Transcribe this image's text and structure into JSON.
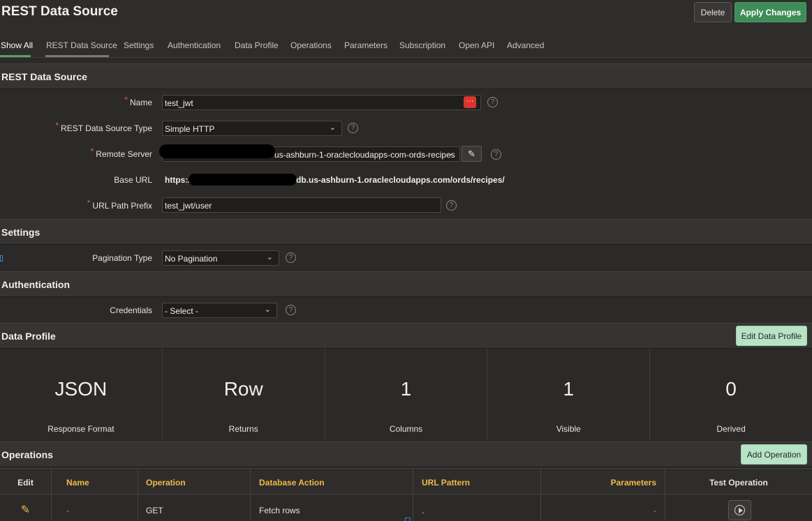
{
  "header": {
    "title": "REST Data Source",
    "delete_label": "Delete",
    "apply_label": "Apply Changes"
  },
  "tabs": [
    {
      "label": "Show All"
    },
    {
      "label": "REST Data Source"
    },
    {
      "label": "Settings"
    },
    {
      "label": "Authentication"
    },
    {
      "label": "Data Profile"
    },
    {
      "label": "Operations"
    },
    {
      "label": "Parameters"
    },
    {
      "label": "Subscription"
    },
    {
      "label": "Open API"
    },
    {
      "label": "Advanced"
    }
  ],
  "colors": {
    "accent_green": "#3e8d58",
    "required_star": "#e25a4a",
    "column_header": "#f0b94a",
    "light_button": "#b9e3c6"
  },
  "rest_section": {
    "title": "REST Data Source",
    "name_label": "Name",
    "name_value": "test_jwt",
    "type_label": "REST Data Source Type",
    "type_value": "Simple HTTP",
    "server_label": "Remote Server",
    "server_value": "us-ashburn-1-oraclecloudapps-com-ords-recipes",
    "base_url_label": "Base URL",
    "base_url_prefix": "https:/",
    "base_url_suffix": "db.us-ashburn-1.oraclecloudapps.com/ords/recipes/",
    "path_label": "URL Path Prefix",
    "path_value": "test_jwt/user"
  },
  "settings_section": {
    "title": "Settings",
    "pagination_label": "Pagination Type",
    "pagination_value": "No Pagination"
  },
  "auth_section": {
    "title": "Authentication",
    "credentials_label": "Credentials",
    "credentials_value": "- Select -"
  },
  "data_profile": {
    "title": "Data Profile",
    "edit_label": "Edit Data Profile",
    "tiles": [
      {
        "value": "JSON",
        "label": "Response Format"
      },
      {
        "value": "Row",
        "label": "Returns"
      },
      {
        "value": "1",
        "label": "Columns"
      },
      {
        "value": "1",
        "label": "Visible"
      },
      {
        "value": "0",
        "label": "Derived"
      }
    ]
  },
  "operations": {
    "title": "Operations",
    "add_label": "Add Operation",
    "columns": [
      "Edit",
      "Name",
      "Operation",
      "Database Action",
      "URL Pattern",
      "Parameters",
      "Test Operation"
    ],
    "rows": [
      {
        "name": "-",
        "operation": "GET",
        "db_action": "Fetch rows",
        "url_pattern": ".",
        "parameters": "-"
      }
    ]
  }
}
